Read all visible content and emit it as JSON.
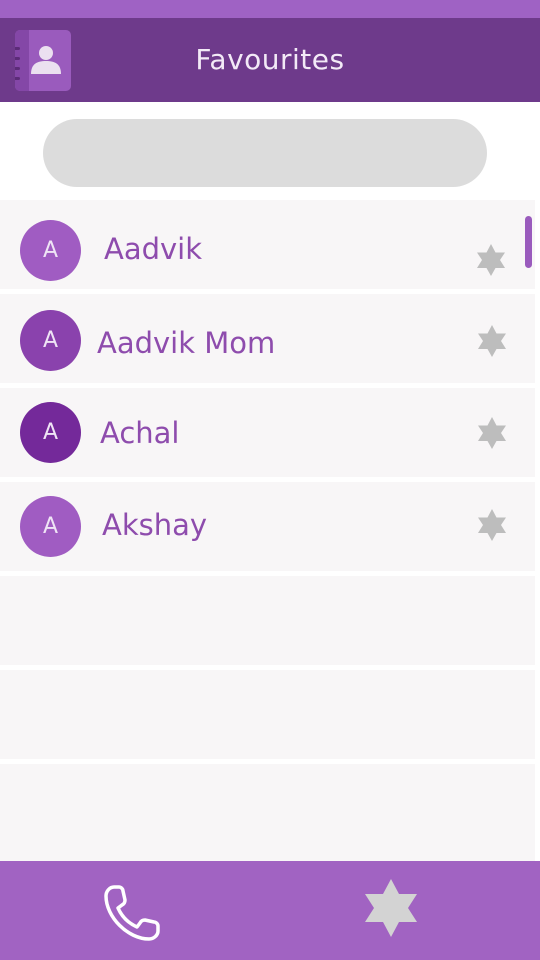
{
  "header": {
    "title": "Favourites",
    "app_icon": "contacts-book-icon"
  },
  "search": {
    "placeholder": "",
    "value": ""
  },
  "contacts": [
    {
      "initial": "A",
      "name": "Aadvik",
      "avatar_color": "#a05cc2",
      "favourite": true
    },
    {
      "initial": "A",
      "name": "Aadvik Mom",
      "avatar_color": "#8a42ad",
      "favourite": true
    },
    {
      "initial": "A",
      "name": "Achal",
      "avatar_color": "#74299a",
      "favourite": true
    },
    {
      "initial": "A",
      "name": "Akshay",
      "avatar_color": "#a05cc2",
      "favourite": true
    }
  ],
  "bottom_nav": [
    {
      "icon": "phone-icon",
      "active": false
    },
    {
      "icon": "star-icon",
      "active": true
    }
  ],
  "colors": {
    "accent": "#6e3a8b",
    "bottom_bar": "#a163c2",
    "name_text": "#8e4cad",
    "star": "#bdbdbd",
    "row_bg": "#f8f6f7"
  }
}
